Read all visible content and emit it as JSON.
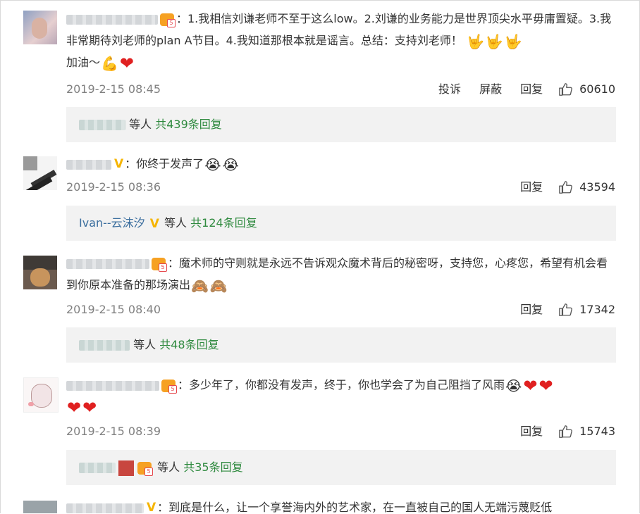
{
  "colors": {
    "reply_box_bg": "#f2f2f2",
    "reply_count": "#2f8a3f",
    "vip_v": "#f5b400",
    "heart": "#e02020"
  },
  "comments": [
    {
      "content": "：1.我相信刘谦老师不至于这么low。2.刘谦的业务能力是世界顶尖水平毋庸置疑。3.我非常期待刘老师的plan A节目。4.我知道那根本就是谣言。总结：支持刘老师！",
      "content_tail": "加油～",
      "time": "2019-2-15 08:45",
      "report": "投诉",
      "block": "屏蔽",
      "reply": "回复",
      "likes": "60610",
      "reply_suffix": "等人",
      "reply_count": "共439条回复"
    },
    {
      "content": "：你终于发声了",
      "time": "2019-2-15 08:36",
      "reply": "回复",
      "likes": "43594",
      "reply_user": "Ivan--云沫汐",
      "reply_suffix": "等人",
      "reply_count": "共124条回复"
    },
    {
      "content": "：魔术师的守则就是永远不告诉观众魔术背后的秘密呀，支持您，心疼您，希望有机会看到你原本准备的那场演出",
      "time": "2019-2-15 08:40",
      "reply": "回复",
      "likes": "17342",
      "reply_suffix": "等人",
      "reply_count": "共48条回复"
    },
    {
      "content": "：多少年了，你都没有发声，终于，你也学会了为自己阻挡了风雨",
      "time": "2019-2-15 08:39",
      "reply": "回复",
      "likes": "15743",
      "reply_suffix": "等人",
      "reply_count": "共35条回复"
    },
    {
      "content": "：到底是什么，让一个享誉海内外的艺术家，在一直被自己的国人无端污蔑贬低"
    }
  ],
  "icons": {
    "like": "thumbs-up-icon",
    "rock": "rock-hand-emoji",
    "muscle": "flexed-bicep-emoji",
    "heart": "red-heart-emoji",
    "cry": "crying-face-emoji",
    "monkey": "see-no-evil-emoji"
  }
}
